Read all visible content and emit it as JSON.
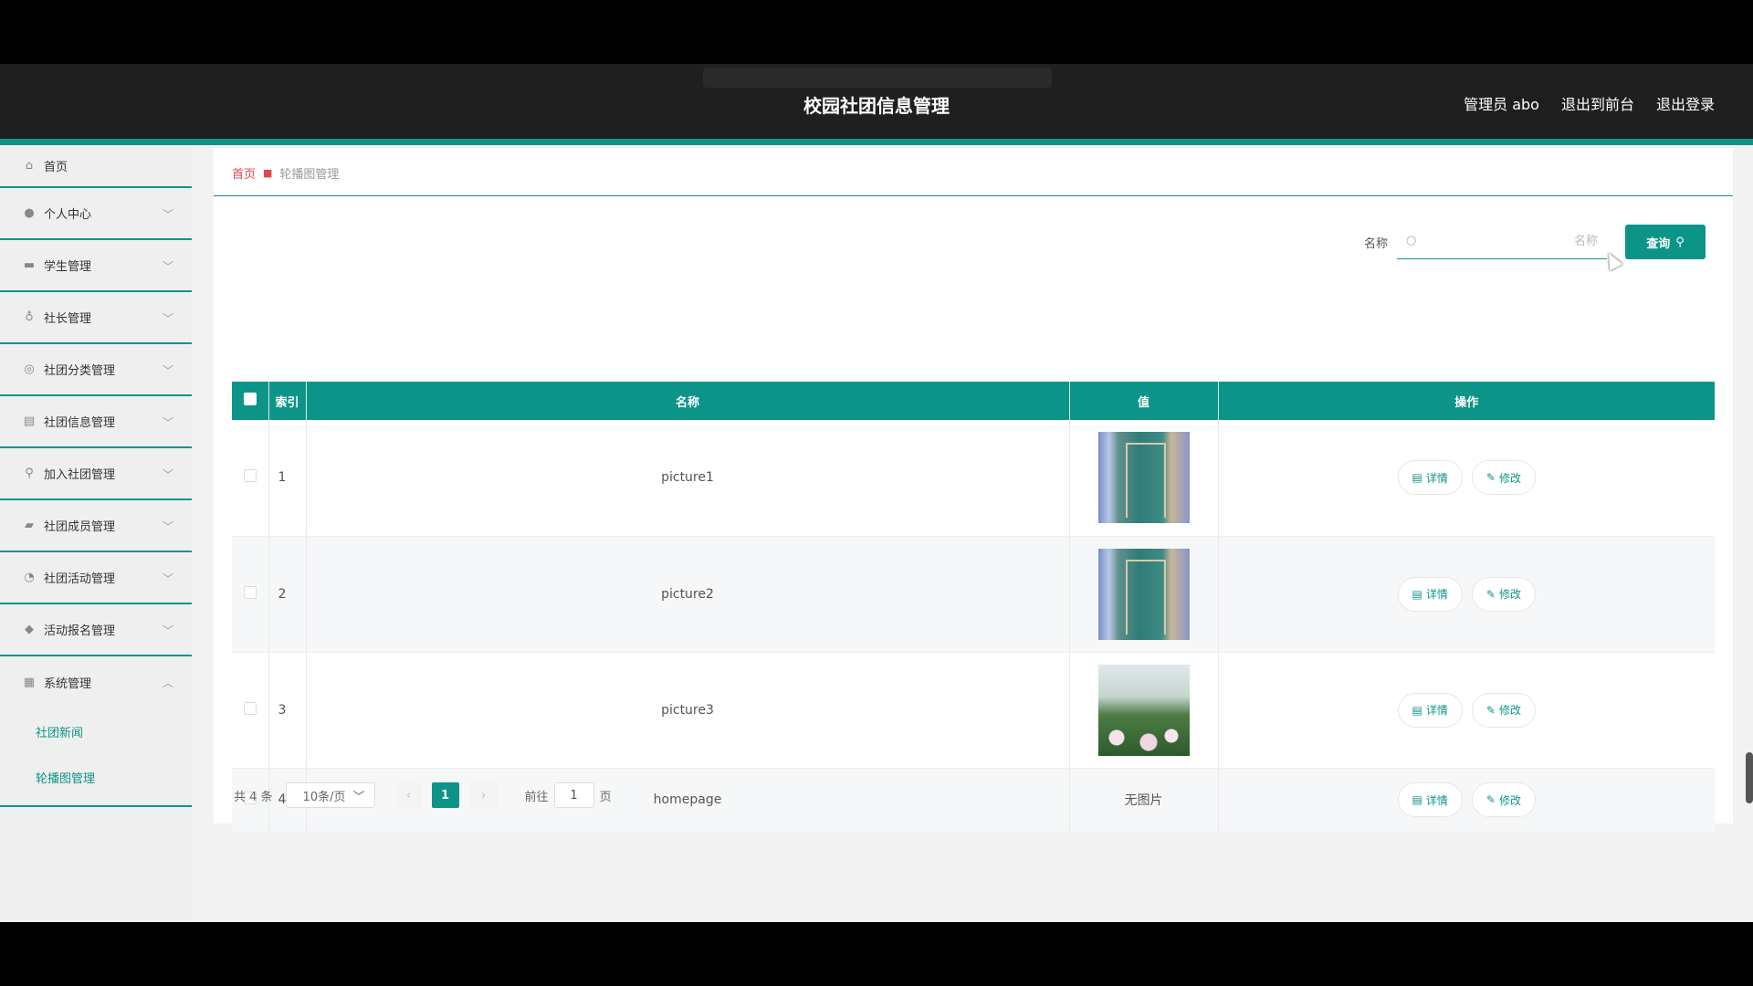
{
  "header": {
    "title": "校园社团信息管理",
    "user": "管理员 abo",
    "to_front": "退出到前台",
    "logout": "退出登录"
  },
  "sidebar": {
    "items": [
      {
        "label": "首页",
        "icon": "home-icon"
      },
      {
        "label": "个人中心",
        "icon": "user-icon"
      },
      {
        "label": "学生管理",
        "icon": "briefcase-icon"
      },
      {
        "label": "社长管理",
        "icon": "microphone-icon"
      },
      {
        "label": "社团分类管理",
        "icon": "circle-icon"
      },
      {
        "label": "社团信息管理",
        "icon": "clipboard-icon"
      },
      {
        "label": "加入社团管理",
        "icon": "bulb-icon"
      },
      {
        "label": "社团成员管理",
        "icon": "chat-icon"
      },
      {
        "label": "社团活动管理",
        "icon": "gauge-icon"
      },
      {
        "label": "活动报名管理",
        "icon": "location-icon"
      },
      {
        "label": "系统管理",
        "icon": "chart-icon"
      }
    ],
    "sub_items": [
      "社团新闻",
      "轮播图管理"
    ]
  },
  "breadcrumb": {
    "home": "首页",
    "current": "轮播图管理"
  },
  "search": {
    "label": "名称",
    "placeholder": "名称",
    "button": "查询"
  },
  "table": {
    "headers": {
      "index": "索引",
      "name": "名称",
      "value": "值",
      "actions": "操作"
    },
    "rows": [
      {
        "index": "1",
        "name": "picture1",
        "image": "door"
      },
      {
        "index": "2",
        "name": "picture2",
        "image": "door"
      },
      {
        "index": "3",
        "name": "picture3",
        "image": "flower"
      },
      {
        "index": "4",
        "name": "homepage",
        "image": "",
        "no_image": "无图片"
      }
    ],
    "detail_label": "详情",
    "edit_label": "修改"
  },
  "pagination": {
    "total": "共 4 条",
    "page_size": "10条/页",
    "current_page": "1",
    "goto_label": "前往",
    "goto_value": "1",
    "page_suffix": "页"
  },
  "colors": {
    "accent": "#0d9488",
    "breadcrumb_home": "#e0474a",
    "header_bg": "#1f1f1f"
  }
}
